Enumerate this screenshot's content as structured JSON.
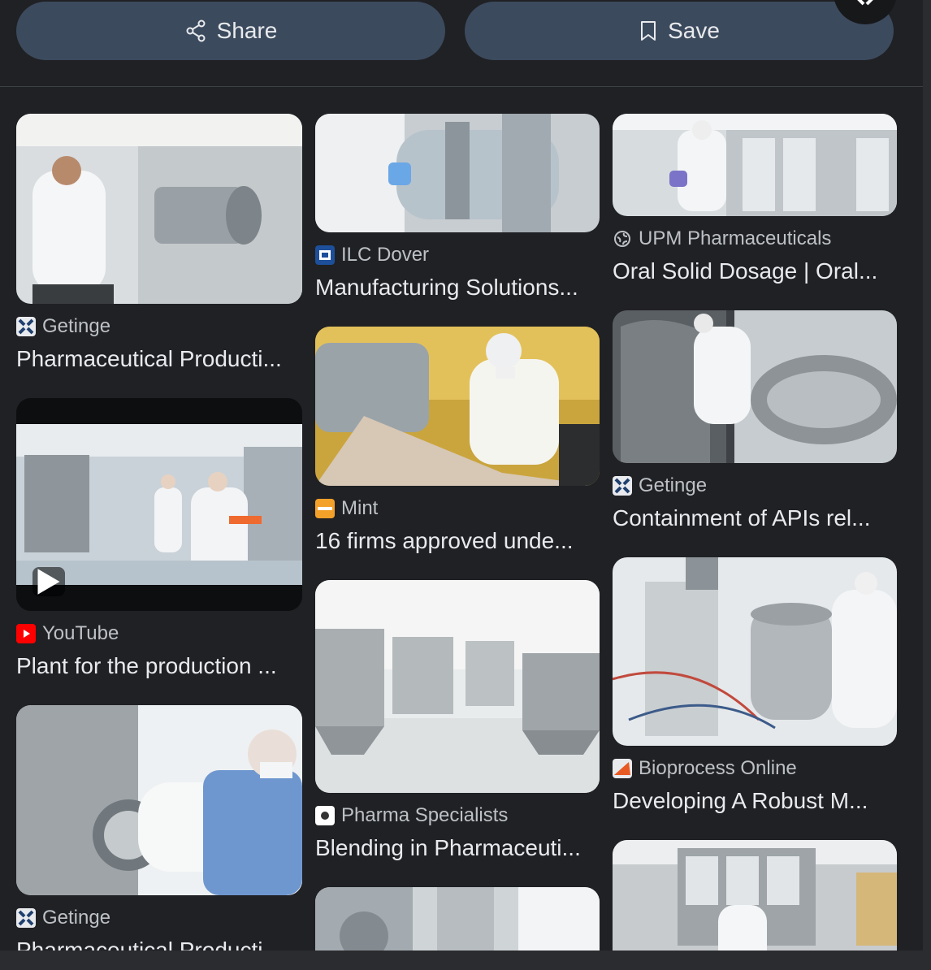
{
  "actions": {
    "share_label": "Share",
    "save_label": "Save"
  },
  "colors": {
    "background": "#202124",
    "pill": "#3c4a5e",
    "text": "#e8eaed",
    "source_text": "#bdc1c6"
  },
  "results": [
    {
      "source": "Getinge",
      "title": "Pharmaceutical Producti...",
      "favicon": "getinge-icon"
    },
    {
      "source": "YouTube",
      "title": "Plant for the production ...",
      "favicon": "youtube-icon"
    },
    {
      "source": "Getinge",
      "title": "Pharmaceutical Producti",
      "favicon": "getinge-icon"
    },
    {
      "source": "ILC Dover",
      "title": "Manufacturing Solutions...",
      "favicon": "ilc-dover-icon"
    },
    {
      "source": "Mint",
      "title": "16 firms approved unde...",
      "favicon": "mint-icon"
    },
    {
      "source": "Pharma Specialists",
      "title": "Blending in Pharmaceuti...",
      "favicon": "pharma-specialists-icon"
    },
    {
      "source": "UPM Pharmaceuticals",
      "title": "Oral Solid Dosage | Oral...",
      "favicon": "globe-icon"
    },
    {
      "source": "Getinge",
      "title": "Containment of APIs rel...",
      "favicon": "getinge-icon"
    },
    {
      "source": "Bioprocess Online",
      "title": "Developing A Robust M...",
      "favicon": "bioprocess-icon"
    }
  ]
}
